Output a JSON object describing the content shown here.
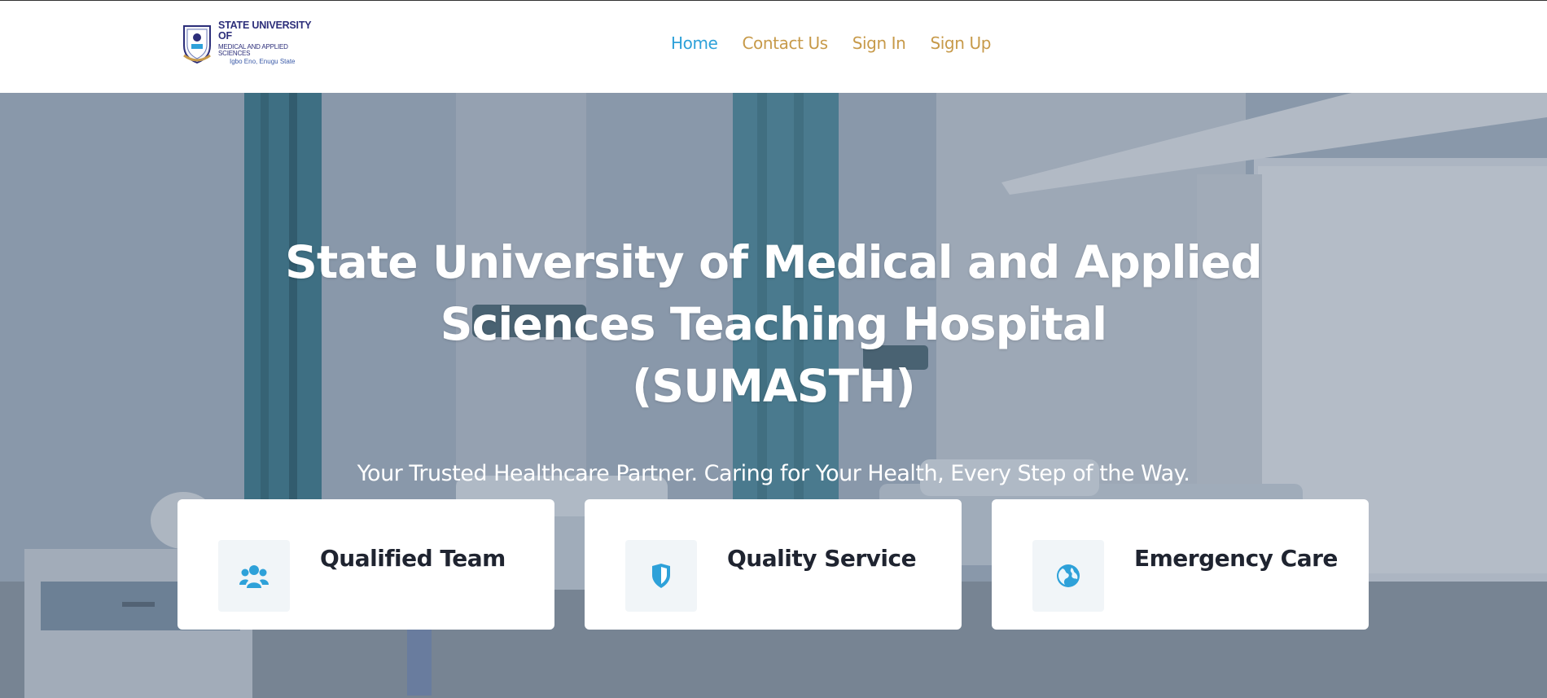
{
  "brand": {
    "line1": "STATE UNIVERSITY OF",
    "line2": "MEDICAL AND APPLIED SCIENCES",
    "line3": "Igbo Eno, Enugu State"
  },
  "nav": {
    "items": [
      {
        "label": "Home",
        "active": true
      },
      {
        "label": "Contact Us",
        "active": false
      },
      {
        "label": "Sign In",
        "active": false
      },
      {
        "label": "Sign Up",
        "active": false
      }
    ]
  },
  "hero": {
    "title_line1": "State University of Medical and Applied",
    "title_line2": "Sciences Teaching Hospital",
    "title_line3": "(SUMASTH)",
    "subtitle": "Your Trusted Healthcare Partner. Caring for Your Health, Every Step of the Way."
  },
  "features": [
    {
      "title": "Qualified Team",
      "icon": "users-icon"
    },
    {
      "title": "Quality Service",
      "icon": "shield-icon"
    },
    {
      "title": "Emergency Care",
      "icon": "globe-icon"
    }
  ],
  "colors": {
    "accent_blue": "#2ea1d9",
    "nav_gold": "#c79a4a",
    "brand_navy": "#2c2e7a"
  }
}
